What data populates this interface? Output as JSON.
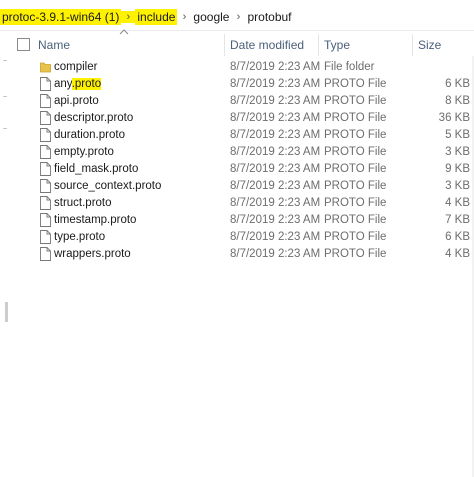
{
  "breadcrumb": {
    "items": [
      "protoc-3.9.1-win64 (1)",
      "include",
      "google",
      "protobuf"
    ],
    "separator_icon": "chevron-right-icon"
  },
  "columns": {
    "name": "Name",
    "date_modified": "Date modified",
    "type": "Type",
    "size": "Size"
  },
  "files": [
    {
      "name": "compiler",
      "date": "8/7/2019 2:23 AM",
      "type": "File folder",
      "size": "",
      "icon": "folder-icon"
    },
    {
      "name": "any.proto",
      "date": "8/7/2019 2:23 AM",
      "type": "PROTO File",
      "size": "6 KB",
      "icon": "file-icon"
    },
    {
      "name": "api.proto",
      "date": "8/7/2019 2:23 AM",
      "type": "PROTO File",
      "size": "8 KB",
      "icon": "file-icon"
    },
    {
      "name": "descriptor.proto",
      "date": "8/7/2019 2:23 AM",
      "type": "PROTO File",
      "size": "36 KB",
      "icon": "file-icon"
    },
    {
      "name": "duration.proto",
      "date": "8/7/2019 2:23 AM",
      "type": "PROTO File",
      "size": "5 KB",
      "icon": "file-icon"
    },
    {
      "name": "empty.proto",
      "date": "8/7/2019 2:23 AM",
      "type": "PROTO File",
      "size": "3 KB",
      "icon": "file-icon"
    },
    {
      "name": "field_mask.proto",
      "date": "8/7/2019 2:23 AM",
      "type": "PROTO File",
      "size": "9 KB",
      "icon": "file-icon"
    },
    {
      "name": "source_context.proto",
      "date": "8/7/2019 2:23 AM",
      "type": "PROTO File",
      "size": "3 KB",
      "icon": "file-icon"
    },
    {
      "name": "struct.proto",
      "date": "8/7/2019 2:23 AM",
      "type": "PROTO File",
      "size": "4 KB",
      "icon": "file-icon"
    },
    {
      "name": "timestamp.proto",
      "date": "8/7/2019 2:23 AM",
      "type": "PROTO File",
      "size": "7 KB",
      "icon": "file-icon"
    },
    {
      "name": "type.proto",
      "date": "8/7/2019 2:23 AM",
      "type": "PROTO File",
      "size": "6 KB",
      "icon": "file-icon"
    },
    {
      "name": "wrappers.proto",
      "date": "8/7/2019 2:23 AM",
      "type": "PROTO File",
      "size": "4 KB",
      "icon": "file-icon"
    }
  ],
  "colors": {
    "highlight": "#fff200",
    "header_text": "#4c607a",
    "meta_text": "#6d6d6d",
    "folder": "#e8c24a"
  }
}
